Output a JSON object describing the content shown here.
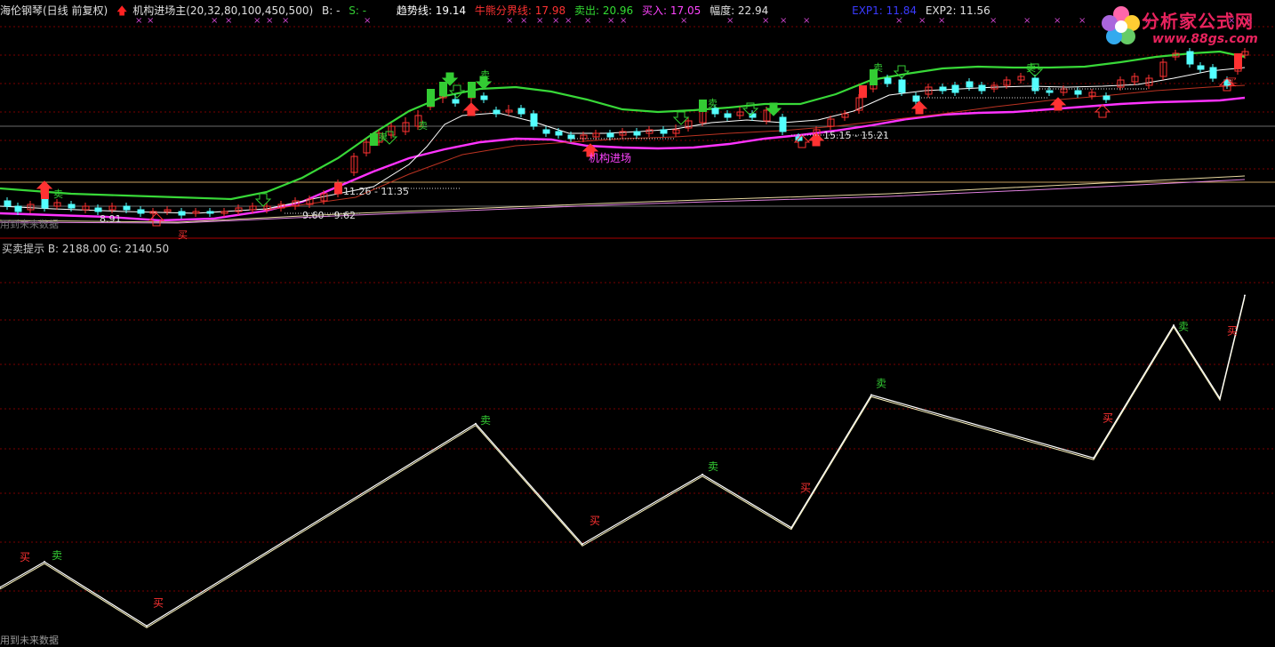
{
  "header": {
    "stock": "海伦钢琴(日线 前复权)",
    "indicator": "机构进场主(20,32,80,100,450,500)",
    "b_label": "B: -",
    "s_label": "S: -",
    "trend_label": "趋势线: 19.14",
    "bull_label": "牛熊分界线: 17.98",
    "sell_label": "卖出: 20.96",
    "buy_label": "买入: 17.05",
    "range_label": "幅度: 22.94",
    "exp1_label": "EXP1: 11.84",
    "exp2_label": "EXP2: 11.56"
  },
  "logo": {
    "title": "分析家公式网",
    "url": "www.88gs.com"
  },
  "main_chart": {
    "annotations": [
      "11.26 - 11.35",
      "9.60 - 9.62",
      "15.15 - 15.21",
      "8.91",
      "机构进场"
    ],
    "signal_sell": "卖",
    "signal_buy": "买",
    "future_note": "用到未来数据"
  },
  "sub_header": "买卖提示  B: 2188.00  G: 2140.50",
  "footer_note": "用到未来数据",
  "colors": {
    "bg": "#000000",
    "up": "#ff3232",
    "down": "#54ffff",
    "green_line": "#38d838",
    "magenta_line": "#ff33ff",
    "white_line": "#ffffff",
    "grid": "#7a0000",
    "buy": "#ff3232",
    "sell": "#33cc33"
  },
  "chart_data": {
    "type": "line",
    "title": "买卖提示",
    "series": [
      {
        "name": "B",
        "x": [
          0,
          50,
          165,
          535,
          655,
          790,
          890,
          980,
          1230,
          1320,
          1372,
          1400
        ],
        "values": [
          1160,
          1390,
          810,
          2640,
          1550,
          2180,
          1700,
          2900,
          2330,
          3530,
          2870,
          3800
        ]
      }
    ],
    "signals": [
      {
        "type": "买",
        "x": 28
      },
      {
        "type": "卖",
        "x": 64
      },
      {
        "type": "买",
        "x": 178
      },
      {
        "type": "卖",
        "x": 546
      },
      {
        "type": "买",
        "x": 669
      },
      {
        "type": "卖",
        "x": 802
      },
      {
        "type": "买",
        "x": 906
      },
      {
        "type": "卖",
        "x": 991
      },
      {
        "type": "买",
        "x": 1246
      },
      {
        "type": "卖",
        "x": 1331
      },
      {
        "type": "买",
        "x": 1386
      }
    ]
  }
}
